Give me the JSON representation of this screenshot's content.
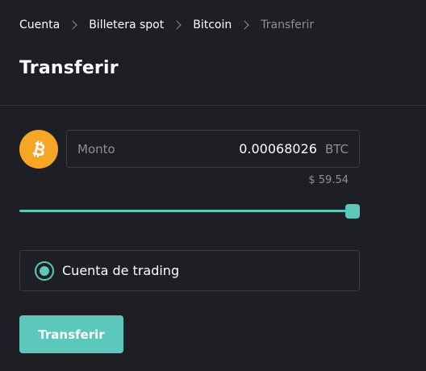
{
  "breadcrumb": {
    "items": [
      "Cuenta",
      "Billetera spot",
      "Bitcoin",
      "Transferir"
    ]
  },
  "page": {
    "title": "Transferir"
  },
  "amount": {
    "label": "Monto",
    "value": "0.00068026",
    "unit": "BTC",
    "fiat_value": "$ 59.54"
  },
  "slider": {
    "percent": 100
  },
  "account_option": {
    "label": "Cuenta de trading",
    "selected": true
  },
  "transfer_button": {
    "label": "Transferir"
  },
  "icons": {
    "coin": "bitcoin-icon"
  },
  "colors": {
    "accent": "#5cc8bb",
    "bitcoin": "#f7a524",
    "background": "#1e1f25"
  }
}
